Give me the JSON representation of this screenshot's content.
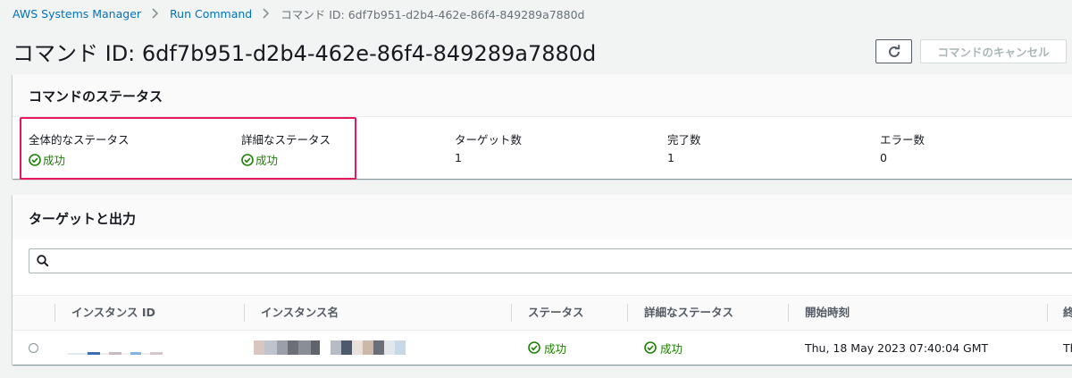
{
  "breadcrumb": {
    "items": [
      "AWS Systems Manager",
      "Run Command"
    ],
    "current": "コマンド ID: 6df7b951-d2b4-462e-86f4-849289a7880d"
  },
  "page": {
    "title": "コマンド ID: 6df7b951-d2b4-462e-86f4-849289a7880d",
    "cancel_label": "コマンドのキャンセル"
  },
  "status_panel": {
    "header": "コマンドのステータス",
    "fields": [
      {
        "label": "全体的なステータス",
        "value": "成功",
        "status": "success"
      },
      {
        "label": "詳細なステータス",
        "value": "成功",
        "status": "success"
      },
      {
        "label": "ターゲット数",
        "value": "1"
      },
      {
        "label": "完了数",
        "value": "1"
      },
      {
        "label": "エラー数",
        "value": "0"
      }
    ]
  },
  "targets_panel": {
    "header": "ターゲットと出力",
    "search_placeholder": "",
    "columns": [
      "インスタンス ID",
      "インスタンス名",
      "ステータス",
      "詳細なステータス",
      "開始時刻",
      "終"
    ],
    "rows": [
      {
        "status": "成功",
        "detailed_status": "成功",
        "start_time": "Thu, 18 May 2023 07:40:04 GMT",
        "end_time_partial": "Th"
      }
    ]
  },
  "colors": {
    "link": "#0073bb",
    "success": "#1d8102",
    "highlight": "#e8175d"
  }
}
